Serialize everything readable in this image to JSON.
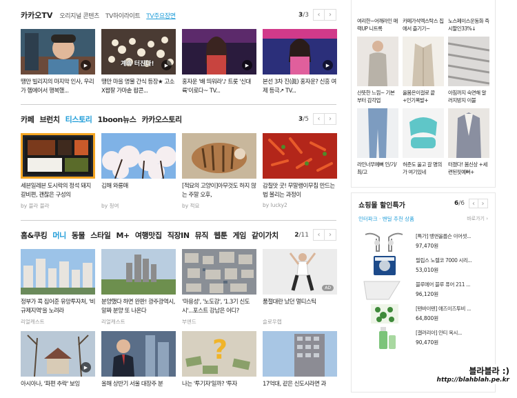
{
  "kakaotv": {
    "title": "카카오TV",
    "tabs": [
      "오리지널 콘텐츠",
      "TV하이라이트",
      "TV주요장면"
    ],
    "pager": {
      "current": "3",
      "total": "/3"
    },
    "cards": [
      {
        "title": "땡만 빌리지의 마지막 인사, 우리가 헴에어서 행복했...",
        "thumb": "man-portrait"
      },
      {
        "title": "땡만 마을 명물 간식 등장★ 고소X짭잘 가마솥 팝콘...",
        "thumb": "popcorn",
        "caption": "계속 터진다!"
      },
      {
        "title": "홍자운 '배 띄워라'♪ 트롯 '신대륙'이로다~ TV...",
        "thumb": "singer-1"
      },
      {
        "title": "본선 3차 진(眞) 홍자운? 신흥 여제 등극↗ TV...",
        "thumb": "singer-2"
      }
    ]
  },
  "cafe": {
    "tabs": [
      "카페",
      "브런치",
      "티스토리",
      "1boon뉴스",
      "카카오스토리"
    ],
    "pager": {
      "current": "3",
      "total": "/5"
    },
    "cards": [
      {
        "title": "세븐일레븐 도시락의 정석 돼지갈비편, 괜찮은 구성의",
        "source": "by 블라 블라",
        "thumb": "lunchbox"
      },
      {
        "title": "김해 와룡매",
        "source": "by 청여",
        "thumb": "blossom"
      },
      {
        "title": "[적묘의 고양이]아무것도 하지 않는 주말 오후,",
        "source": "by 적묘",
        "thumb": "cat"
      },
      {
        "title": "감칠맛 굿! 무말랭이무침 만드는 법 볼리는 과정이",
        "source": "by lucky2",
        "thumb": "kimchi"
      }
    ]
  },
  "home": {
    "tabs": [
      "홈&쿠킹",
      "머니",
      "동물",
      "스타일",
      "M+",
      "여행맛집",
      "직장IN",
      "뮤직",
      "웹툰",
      "게임",
      "같이가치"
    ],
    "pager": {
      "current": "2",
      "total": "/11"
    },
    "cards": [
      {
        "title": "정부가 콕 집어준 유망투자처, '비규제지역'을 노려라",
        "source": "리얼캐스트",
        "thumb": "city"
      },
      {
        "title": "분양했다 하면 완판! 광주광역시, 알짜 분양 또 나온다",
        "source": "리얼캐스트",
        "thumb": "tower"
      },
      {
        "title": "'마용성', '노도강', '1.3기 신도시'...포스트 강남은 어디?",
        "source": "부엔드",
        "thumb": "aerial"
      },
      {
        "title": "품절대란 났던 멀티스틱",
        "source": "슬로우랩",
        "thumb": "workout",
        "ad": "AD"
      },
      {
        "title": "아시아나, '파편 추락' 보잉",
        "thumb": "house"
      },
      {
        "title": "올해 상반기 서울 대장주 분",
        "thumb": "man-suit"
      },
      {
        "title": "나는 '투기자'일까? '투자",
        "thumb": "question"
      },
      {
        "title": "17억대, 같은 신도시라면 과",
        "thumb": "building"
      }
    ]
  },
  "shopping": {
    "items": [
      {
        "text": "여리한~어깨라인 매력UP 니트록",
        "thumb": "knit",
        "color": "#c9b7a6"
      },
      {
        "text": "카페가석엑스탁스 집에서 즐기기~",
        "thumb": "cafe",
        "color": "#5a4a3c"
      },
      {
        "text": "노스페이스운동화 즉시할인33%↓",
        "thumb": "shoes",
        "color": "#3b3b3b"
      },
      {
        "text": "산뜻한 느낌~ 기본부터 감각업",
        "thumb": "model-1",
        "color": "#b8b2a8"
      },
      {
        "text": "올봄은이걸로 끝 +인기폭발+",
        "thumb": "coat",
        "color": "#cfc3b0"
      },
      {
        "text": "아침까지 숙면해 알러지방지 이불",
        "thumb": "blanket",
        "color": "#9c9a98"
      },
      {
        "text": "라인너무예뻐 인/기/최/고",
        "thumb": "jeans",
        "color": "#7d9cc0"
      },
      {
        "text": "허준도 울고 갈 명의가 여기있네",
        "thumb": "cushion",
        "color": "#5fc6c8"
      },
      {
        "text": "터졌다! 봄신상 +세련된핏예뻐+",
        "thumb": "tweed",
        "color": "#8a8fa0"
      }
    ]
  },
  "deals": {
    "title": "쇼핑몰 할인특가",
    "pager": {
      "current": "6",
      "total": "/6"
    },
    "store": "인터파크 · 밴딜 추천 상품",
    "more": "바로가기 ›",
    "items": [
      {
        "name": "[특가] 뱅앤올룹슨 이어셋...",
        "price": "97,470원",
        "thumb": "earphones"
      },
      {
        "name": "필립스 노렐코 7000 시리...",
        "price": "53,010원",
        "thumb": "shaver"
      },
      {
        "name": "블루에어 블루 퓨어 211 ...",
        "price": "96,120원",
        "thumb": "air-purifier"
      },
      {
        "name": "[텐바이텐] 애즈이즈투비 ...",
        "price": "64,800원",
        "thumb": "plant-pack"
      },
      {
        "name": "[갤러리아] 안티 옥시...",
        "price": "90,470원",
        "thumb": "bottle"
      }
    ]
  },
  "watermark": {
    "line1": "블라블라 :)",
    "line2": "http://blahblah.pe.kr"
  }
}
